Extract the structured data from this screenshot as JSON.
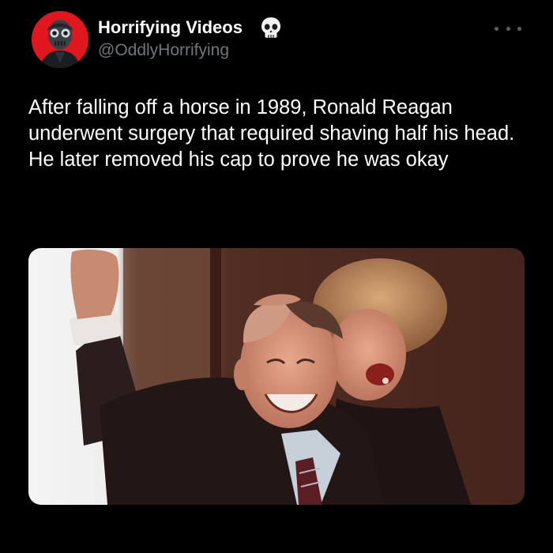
{
  "account": {
    "display_name": "Horrifying Videos",
    "handle": "@OddlyHorrifying",
    "avatar_icon": "masked-figure-avatar",
    "badge_icon": "skull-icon"
  },
  "post": {
    "text": "After falling off a horse in 1989, Ronald Reagan underwent surgery that required shaving half his head. He later removed his cap to prove he was okay",
    "media_description_icon": "photo"
  },
  "colors": {
    "background": "#000000",
    "primary_text": "#e7e9ea",
    "secondary_text": "#71767b",
    "avatar_bg": "#e0171f"
  }
}
